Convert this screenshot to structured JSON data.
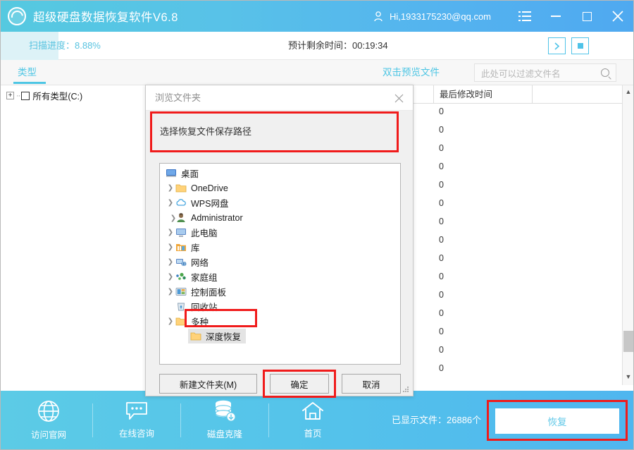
{
  "titlebar": {
    "app_title": "超级硬盘数据恢复软件V6.8",
    "user_greeting": "Hi,1933175230@qq.com",
    "menu_icon": "hamburger-menu-icon",
    "minimize_icon": "minimize-icon",
    "maximize_icon": "maximize-icon",
    "close_icon": "close-icon",
    "accent": "#55c4ea"
  },
  "progress": {
    "scan_label": "扫描进度：8.88%",
    "percent": 8.88,
    "eta_label": "预计剩余时间：00:19:34",
    "resume_icon": "play-chevron-icon",
    "stop_icon": "stop-square-icon"
  },
  "toolbar": {
    "tab_type": "类型",
    "preview_hint": "双击预览文件",
    "filter_placeholder": "此处可以过滤文件名",
    "filter_value": "",
    "search_icon": "search-icon"
  },
  "left_tree": {
    "root_label": "所有类型(C:)",
    "expander": "+",
    "checked": false
  },
  "file_list": {
    "columns": [
      "最后修改时间",
      ""
    ],
    "rows": [
      "0",
      "0",
      "0",
      "0",
      "0",
      "0",
      "0",
      "0",
      "0",
      "0",
      "0",
      "0",
      "0",
      "0",
      "0"
    ],
    "scroll_up_icon": "chevron-up-icon",
    "scroll_down_icon": "chevron-down-icon"
  },
  "dialog": {
    "title": "浏览文件夹",
    "close_icon": "close-icon",
    "prompt": "选择恢复文件保存路径",
    "tree": [
      {
        "label": "桌面",
        "icon": "desktop-icon",
        "indent": 0,
        "arrow": false
      },
      {
        "label": "OneDrive",
        "icon": "onedrive-folder-icon",
        "indent": 1,
        "arrow": true
      },
      {
        "label": "WPS网盘",
        "icon": "cloud-icon",
        "indent": 1,
        "arrow": true
      },
      {
        "label": "Administrator",
        "icon": "user-icon",
        "indent": 1,
        "arrow": true
      },
      {
        "label": "此电脑",
        "icon": "computer-icon",
        "indent": 1,
        "arrow": true
      },
      {
        "label": "库",
        "icon": "library-icon",
        "indent": 1,
        "arrow": true
      },
      {
        "label": "网络",
        "icon": "network-icon",
        "indent": 1,
        "arrow": true
      },
      {
        "label": "家庭组",
        "icon": "homegroup-icon",
        "indent": 1,
        "arrow": true
      },
      {
        "label": "控制面板",
        "icon": "control-panel-icon",
        "indent": 1,
        "arrow": true
      },
      {
        "label": "回收站",
        "icon": "recycle-bin-icon",
        "indent": 1,
        "arrow": false
      },
      {
        "label": "多种",
        "icon": "folder-icon",
        "indent": 1,
        "arrow": true
      },
      {
        "label": "深度恢复",
        "icon": "folder-icon",
        "indent": 2,
        "arrow": false,
        "selected": true
      }
    ],
    "buttons": {
      "new_folder": "新建文件夹(M)",
      "ok": "确定",
      "cancel": "取消"
    },
    "highlight_color": "#f01b1b"
  },
  "bottombar": {
    "items": [
      {
        "label": "访问官网",
        "icon": "globe-icon"
      },
      {
        "label": "在线咨询",
        "icon": "chat-bubble-icon"
      },
      {
        "label": "磁盘克隆",
        "icon": "disk-clone-icon"
      },
      {
        "label": "首页",
        "icon": "home-icon"
      }
    ],
    "shown_files": "已显示文件：26886个",
    "recover_label": "恢复"
  }
}
